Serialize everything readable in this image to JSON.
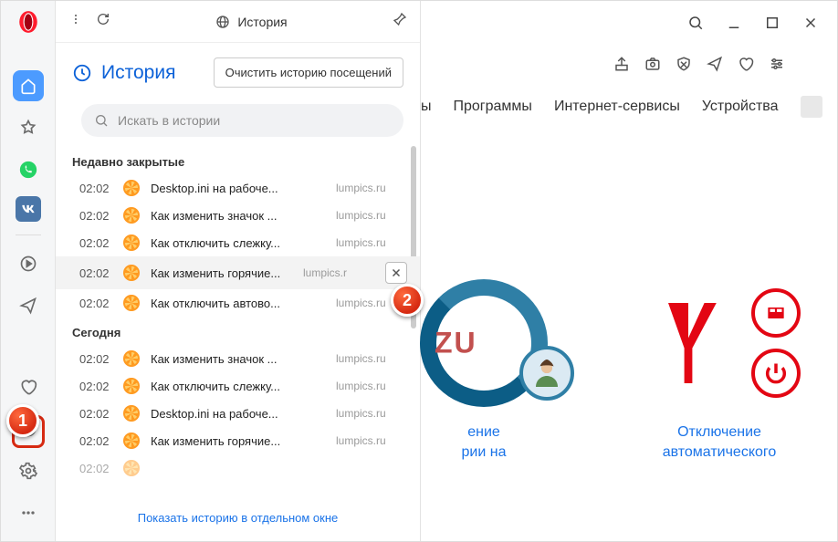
{
  "window": {
    "search": "",
    "minimize": "",
    "maximize": "",
    "close": ""
  },
  "badges": {
    "one": "1",
    "two": "2"
  },
  "sidebar": {
    "items": [
      "opera",
      "home",
      "bookmarks",
      "whatsapp",
      "vk",
      "media",
      "send",
      "heart",
      "history",
      "settings",
      "more"
    ]
  },
  "history_panel": {
    "tab_label": "История",
    "title": "История",
    "clear_label": "Очистить историю посещений",
    "search_placeholder": "Искать в истории",
    "section_recent": "Недавно закрытые",
    "section_today": "Сегодня",
    "recent": [
      {
        "time": "02:02",
        "title": "Desktop.ini на рабоче...",
        "domain": "lumpics.ru"
      },
      {
        "time": "02:02",
        "title": "Как изменить значок ...",
        "domain": "lumpics.ru"
      },
      {
        "time": "02:02",
        "title": "Как отключить слежку...",
        "domain": "lumpics.ru"
      },
      {
        "time": "02:02",
        "title": "Как изменить горячие...",
        "domain": "lumpics.r"
      },
      {
        "time": "02:02",
        "title": "Как отключить автово...",
        "domain": "lumpics.ru"
      }
    ],
    "today": [
      {
        "time": "02:02",
        "title": "Как изменить значок ...",
        "domain": "lumpics.ru"
      },
      {
        "time": "02:02",
        "title": "Как отключить слежку...",
        "domain": "lumpics.ru"
      },
      {
        "time": "02:02",
        "title": "Desktop.ini на рабоче...",
        "domain": "lumpics.ru"
      },
      {
        "time": "02:02",
        "title": "Как изменить горячие...",
        "domain": "lumpics.ru"
      }
    ],
    "show_full": "Показать историю в отдельном окне"
  },
  "main": {
    "nav": [
      "ы",
      "Программы",
      "Интернет-сервисы",
      "Устройства"
    ],
    "tiles": [
      {
        "zu": "ZU",
        "cap1": "ение",
        "cap2": "рии на"
      },
      {
        "cap1": "Отключение",
        "cap2": "автоматического"
      }
    ]
  }
}
